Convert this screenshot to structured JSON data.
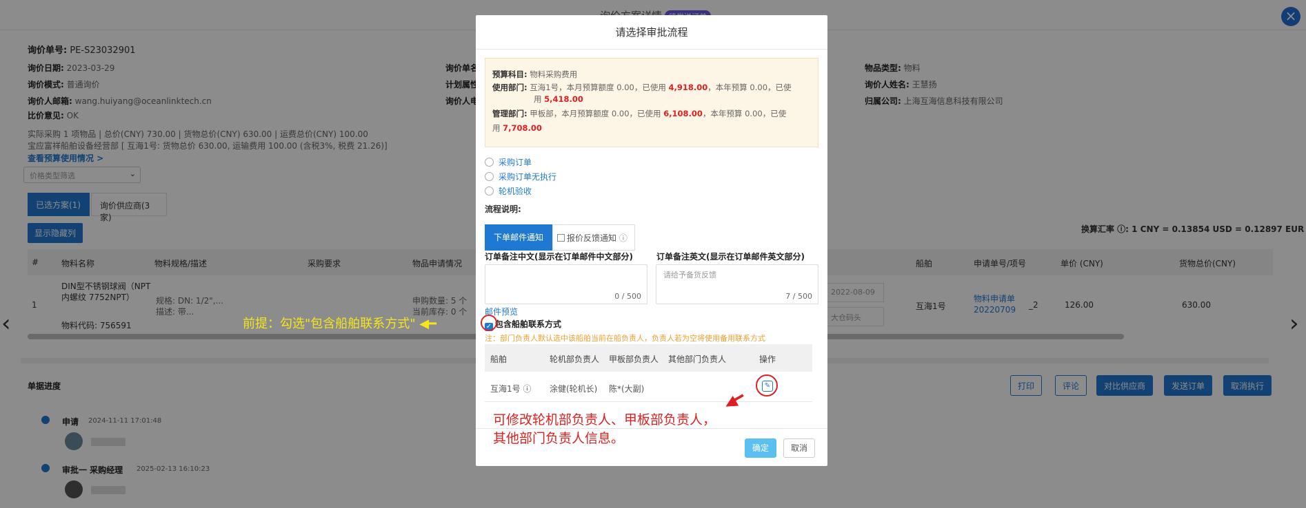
{
  "page": {
    "title": "询价方案详情",
    "badge": "待发送订单",
    "inquiry_no_label": "询价单号:",
    "inquiry_no": "PE-S23032901",
    "date_label": "询价日期:",
    "date": "2023-03-29",
    "mode_label": "询价模式:",
    "mode": "普通询价",
    "email_label": "询价人邮箱:",
    "email": "wang.huiyang@oceanlinktech.cn",
    "opinion_label": "比价意见:",
    "opinion": "OK",
    "col2_a": "询价单名",
    "col2_b": "计划属性",
    "col2_c": "询价人电",
    "type_label": "物品类型:",
    "type": "物料",
    "name_label": "询价人姓名:",
    "name": "王慧扬",
    "company_label": "归属公司:",
    "company": "上海互海信息科技有限公司",
    "summary1": "实际采购 1 项物品  |  总价(CNY) 730.00  |  货物总价(CNY) 630.00  |  运费总价(CNY) 100.00",
    "summary2": "宝应富祥船舶设备经营部 [ 互海1号: 货物总价 630.00, 运输费用 100.00 (含税3%, 税费 21.26)]",
    "budget_link": "查看预算使用情况 >",
    "price_filter": "价格类型筛选",
    "tab_selected": "已选方案(1)",
    "tab_suppliers": "询价供应商(3家)",
    "show_hidden": "显示隐藏列",
    "exchange": "换算汇率 ⓘ: 1 CNY = 0.13854 USD = 0.12897 EUR",
    "columns": [
      "#",
      "物料名称",
      "物料规格/描述",
      "采购要求",
      "物品申请情况",
      "船舶",
      "申请单号/项号",
      "单价 (CNY)",
      "货物总价(CNY)"
    ],
    "row": {
      "index": "1",
      "name": "DIN型不锈钢球阀（NPT内螺纹 7752NPT）",
      "code": "物料代码: 756591",
      "spec": "规格: DN: 1/2\",...",
      "desc": "描述: 带...",
      "qty": "申购数量: 5 个",
      "stock": "当前库存: 0 个",
      "date": "2022-08-09",
      "port": "大仓码头",
      "ship": "互海1号",
      "apply_no": "物料申请单20220709",
      "item_no": "_2",
      "price": "126.00",
      "total": "630.00"
    },
    "progress_title": "单据进度",
    "progress": [
      {
        "step": "申请",
        "time": "2024-11-11 17:01:48"
      },
      {
        "step": "审批一 采购经理",
        "time": "2025-02-13 16:10:23"
      }
    ],
    "actions": [
      "打印",
      "评论",
      "对比供应商",
      "发送订单",
      "取消执行"
    ]
  },
  "modal": {
    "title": "请选择审批流程",
    "budget_subject_label": "预算科目:",
    "budget_subject": "物料采购费用",
    "use_dept_label": "使用部门:",
    "use_dept_text1": "互海1号，本月预算额度 0.00，已使用 ",
    "use_dept_used": "4,918.00",
    "use_dept_text2": "，本年预算 0.00，已使",
    "use_dept_text3": "用 ",
    "use_dept_used_year": "5,418.00",
    "mgmt_dept_label": "管理部门:",
    "mgmt_dept_text1": "甲板部，本月预算额度 0.00，已使用 ",
    "mgmt_dept_used": "6,108.00",
    "mgmt_dept_text2": "，本年预算 0.00，已使",
    "mgmt_dept_text3": "用 ",
    "mgmt_dept_used_year": "7,708.00",
    "flows": [
      "采购订单",
      "采购订单无执行",
      "轮机验收"
    ],
    "flow_desc": "流程说明:",
    "tab_mail": "下单邮件通知",
    "tab_feedback": "报价反馈通知",
    "remark_cn_label": "订单备注中文(显示在订单邮件中文部分)",
    "remark_en_label": "订单备注英文(显示在订单邮件英文部分)",
    "remark_cn_count": "0 / 500",
    "remark_en_placeholder": "请给予备货反馈",
    "remark_en_count": "7 / 500",
    "mail_preview": "邮件预览",
    "include_contact": "包含船舶联系方式",
    "note": "注：部门负责人默认选中该船舶当前在船负责人，负责人若为空将使用备用联系方式",
    "table_head": [
      "船舶",
      "轮机部负责人",
      "甲板部负责人",
      "其他部门负责人",
      "操作"
    ],
    "table_row": {
      "ship": "互海1号",
      "engine": "涂健(轮机长)",
      "deck": "陈*(大副)",
      "other": ""
    },
    "ok": "确定",
    "cancel": "取消"
  },
  "annotations": {
    "premise": "前提：勾选\"包含船舶联系方式\"",
    "edit_tip1": "可修改轮机部负责人、甲板部负责人，",
    "edit_tip2": "其他部门负责人信息。"
  }
}
